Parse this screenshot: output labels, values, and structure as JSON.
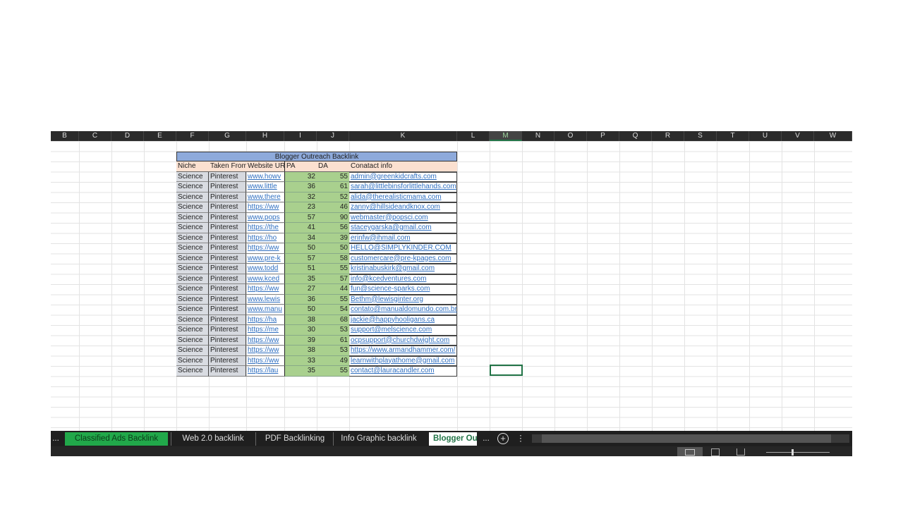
{
  "columns": [
    "B",
    "C",
    "D",
    "E",
    "F",
    "G",
    "H",
    "I",
    "J",
    "K",
    "L",
    "M",
    "N",
    "O",
    "P",
    "Q",
    "R",
    "S",
    "T",
    "U",
    "V",
    "W"
  ],
  "selected_column": "M",
  "table": {
    "title": "Blogger Outreach Backlink",
    "headers": [
      "Niche",
      "Taken From",
      "Website URL",
      "PA",
      "DA",
      "Conatact info"
    ],
    "rows": [
      [
        "Science",
        "Pinterest",
        "www.howv",
        "32",
        "55",
        "admin@greenkidcrafts.com"
      ],
      [
        "Science",
        "Pinterest",
        "www.little",
        "36",
        "61",
        "sarah@littlebinsforlittlehands.com"
      ],
      [
        "Science",
        "Pinterest",
        "www.there",
        "32",
        "52",
        "alida@therealisticmama.com"
      ],
      [
        "Science",
        "Pinterest",
        "https://ww",
        "23",
        "46",
        "zanny@hillsideandknox.com"
      ],
      [
        "Science",
        "Pinterest",
        "www.pops",
        "57",
        "90",
        "webmaster@popsci.com"
      ],
      [
        "Science",
        "Pinterest",
        "https://the",
        "41",
        "56",
        "staceygarska@gmail.com"
      ],
      [
        "Science",
        "Pinterest",
        "https://ho",
        "34",
        "39",
        "erinfw@ihmail.com"
      ],
      [
        "Science",
        "Pinterest",
        "https://ww",
        "50",
        "50",
        "HELLO@SIMPLYKINDER.COM"
      ],
      [
        "Science",
        "Pinterest",
        "www.pre-k",
        "57",
        "58",
        "customercare@pre-kpages.com"
      ],
      [
        "Science",
        "Pinterest",
        "www.todd",
        "51",
        "55",
        "kristinabuskirk@gmail.com"
      ],
      [
        "Science",
        "Pinterest",
        "www.kced",
        "35",
        "57",
        "info@kcedventures.com"
      ],
      [
        "Science",
        "Pinterest",
        "https://ww",
        "27",
        "44",
        "fun@science-sparks.com"
      ],
      [
        "Science",
        "Pinterest",
        "www.lewis",
        "36",
        "55",
        "Bethm@lewisginter.org"
      ],
      [
        "Science",
        "Pinterest",
        "www.manu",
        "50",
        "54",
        "contato@manualdomundo.com.br"
      ],
      [
        "Science",
        "Pinterest",
        "https://ha",
        "38",
        "68",
        "jackie@happyhooligans.ca"
      ],
      [
        "Science",
        "Pinterest",
        "https://me",
        "30",
        "53",
        "support@melscience.com"
      ],
      [
        "Science",
        "Pinterest",
        "https://ww",
        "39",
        "61",
        "ocpsupport@churchdwight.com"
      ],
      [
        "Science",
        "Pinterest",
        "https://ww",
        "38",
        "53",
        "https://www.armandhammer.com/"
      ],
      [
        "Science",
        "Pinterest",
        "https://ww",
        "33",
        "49",
        "learnwithplayathome@gmail.com"
      ],
      [
        "Science",
        "Pinterest",
        "https://lau",
        "35",
        "55",
        "contact@lauracandler.com"
      ]
    ]
  },
  "tabs": {
    "more_left": "...",
    "items": [
      "Classified Ads Backlink",
      "Web 2.0 backlink",
      "PDF Backlinking",
      "Info Graphic backlink",
      "Blogger Outreach Backlink"
    ],
    "active": "Blogger Outreach Backlink",
    "more_right": "...",
    "add": "+",
    "options": "⋮"
  },
  "colors": {
    "active_green": "#21a84a",
    "header_blue": "#8eaadb",
    "header_peach": "#fbe0d0",
    "num_green": "#a9d08e"
  }
}
